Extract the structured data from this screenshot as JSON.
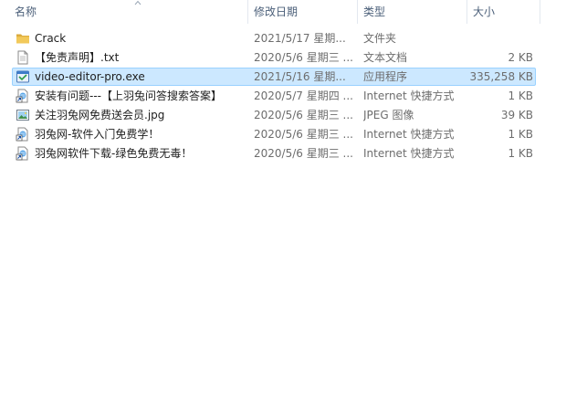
{
  "columns": {
    "name": "名称",
    "date": "修改日期",
    "type": "类型",
    "size": "大小"
  },
  "files": [
    {
      "name": "Crack",
      "date": "2021/5/17 星期...",
      "type": "文件夹",
      "size": "",
      "icon": "folder-icon",
      "selected": false
    },
    {
      "name": "【免责声明】.txt",
      "date": "2020/5/6 星期三 ...",
      "type": "文本文档",
      "size": "2 KB",
      "icon": "text-document-icon",
      "selected": false
    },
    {
      "name": "video-editor-pro.exe",
      "date": "2021/5/16 星期...",
      "type": "应用程序",
      "size": "335,258 KB",
      "icon": "application-icon",
      "selected": true
    },
    {
      "name": "安装有问题---【上羽兔问答搜索答案】",
      "date": "2020/5/7 星期四 ...",
      "type": "Internet 快捷方式",
      "size": "1 KB",
      "icon": "internet-shortcut-icon",
      "selected": false
    },
    {
      "name": "关注羽兔网免费送会员.jpg",
      "date": "2020/5/6 星期三 ...",
      "type": "JPEG 图像",
      "size": "39 KB",
      "icon": "image-file-icon",
      "selected": false
    },
    {
      "name": "羽兔网-软件入门免费学！",
      "date": "2020/5/6 星期三 ...",
      "type": "Internet 快捷方式",
      "size": "1 KB",
      "icon": "internet-shortcut-icon",
      "selected": false
    },
    {
      "name": "羽兔网软件下载-绿色免费无毒！",
      "date": "2020/5/6 星期三 ...",
      "type": "Internet 快捷方式",
      "size": "1 KB",
      "icon": "internet-shortcut-icon",
      "selected": false
    }
  ],
  "colors": {
    "header_text": "#4c607a",
    "selection_fill": "#cce8ff",
    "selection_border": "#99d1ff",
    "folder": "#e8b945"
  }
}
